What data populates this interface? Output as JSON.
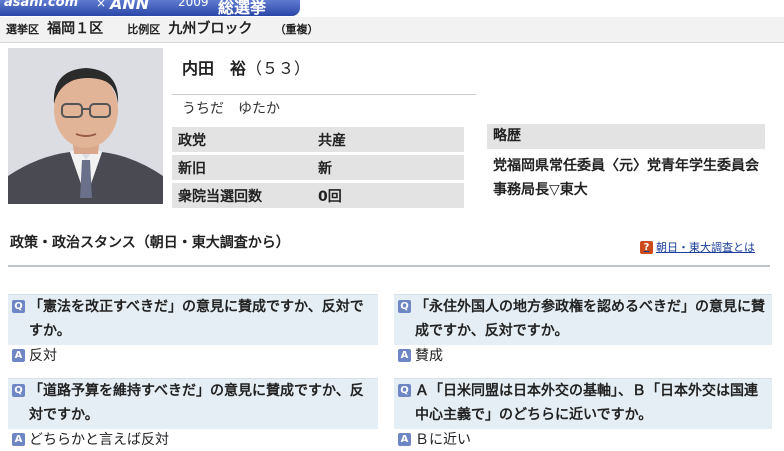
{
  "banner": {
    "logo": "asahi.com",
    "times": "×",
    "ann": "ANN",
    "year": "2009",
    "election": "総選挙"
  },
  "district": {
    "label1": "選挙区",
    "value1": "福岡１区",
    "label2": "比例区",
    "value2": "九州ブロック",
    "dup": "（重複）"
  },
  "candidate": {
    "name": "内田　裕",
    "age": "（５３）",
    "kana": "うちだ　ゆたか"
  },
  "info": [
    {
      "key": "政党",
      "value": "共産"
    },
    {
      "key": "新旧",
      "value": "新"
    },
    {
      "key": "衆院当選回数",
      "value": "0回"
    }
  ],
  "career": {
    "heading": "略歴",
    "text": "党福岡県常任委員〈元〉党青年学生委員会事務局長▽東大"
  },
  "policy": {
    "title": "政策・政治スタンス（朝日・東大調査から）",
    "link": "朝日・東大調査とは",
    "link_icon": "?",
    "q_icon": "Q",
    "a_icon": "A",
    "items": [
      {
        "q": "「憲法を改正すべきだ」の意見に賛成ですか、反対ですか。",
        "a": "反対"
      },
      {
        "q": "「永住外国人の地方参政権を認めるべきだ」の意見に賛成ですか、反対ですか。",
        "a": "賛成"
      },
      {
        "q": "「道路予算を維持すべきだ」の意見に賛成ですか、反対ですか。",
        "a": "どちらかと言えば反対"
      },
      {
        "q": "Ａ「日米同盟は日本外交の基軸」、Ｂ「日本外交は国連中心主義で」のどちらに近いですか。",
        "a": "Ｂに近い"
      }
    ]
  }
}
